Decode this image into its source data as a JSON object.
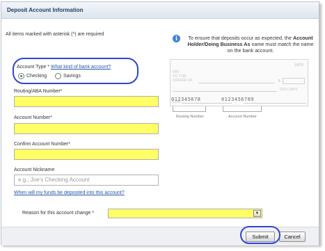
{
  "header": {
    "title": "Deposit Account Information"
  },
  "required_note": "All items marked with asterisk (*) are required",
  "info": {
    "pre": "To ensure that deposits occur as expected, the",
    "strong": "Account Holder/Doing Business As",
    "post": "name must match the name on the bank account."
  },
  "check_image": {
    "number": "1600",
    "pay_to": "PAY\nTO THE\nORDER OF",
    "dollar_sign": "$",
    "dollars": "DOLLARS",
    "for": "FOR",
    "routing_digits": "012345678",
    "account_digits": "0123456789",
    "routing_caption": "Routing Number",
    "account_caption": "Account Number"
  },
  "account_type": {
    "label": "Account Type *",
    "help_link": "What kind of bank account?",
    "options": [
      "Checking",
      "Savings"
    ],
    "selected": "Checking"
  },
  "fields": {
    "routing": {
      "label": "Routing/ABA Number*",
      "value": ""
    },
    "account": {
      "label": "Account Number*",
      "value": ""
    },
    "confirm": {
      "label": "Confirm Account Number*",
      "value": ""
    },
    "nickname": {
      "label": "Account Nickname",
      "placeholder": "e.g., Joe's Checking Account"
    }
  },
  "deposit_link": "When will my funds be deposited into this account?",
  "reason": {
    "label": "Reason for this account change *",
    "value": ""
  },
  "buttons": {
    "submit": "Submit",
    "cancel": "Cancel"
  },
  "colors": {
    "required_field": "#ffff66",
    "highlight": "#2f45d2",
    "link": "#2255aa",
    "header_text": "#1f3d66"
  }
}
